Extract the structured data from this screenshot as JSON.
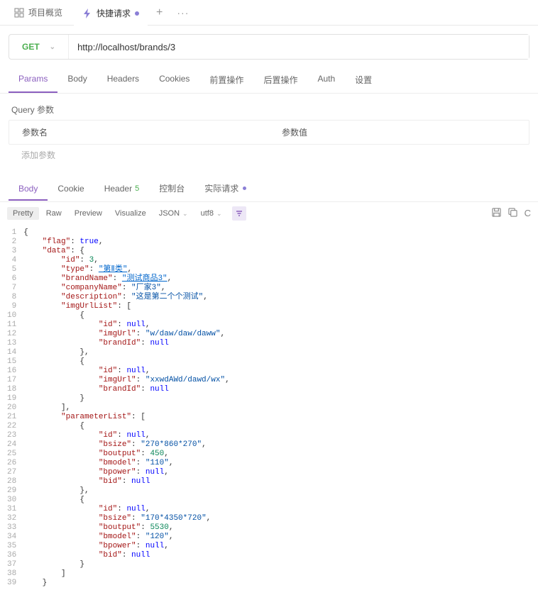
{
  "tabs": {
    "items": [
      {
        "label": "项目概览",
        "icon": "grid-icon"
      },
      {
        "label": "快捷请求",
        "icon": "lightning-icon",
        "active": true,
        "dirty": true
      }
    ],
    "plus": "+",
    "more": "···"
  },
  "request": {
    "method": "GET",
    "url": "http://localhost/brands/3"
  },
  "subTabs": [
    "Params",
    "Body",
    "Headers",
    "Cookies",
    "前置操作",
    "后置操作",
    "Auth",
    "设置"
  ],
  "activeSubTab": "Params",
  "query": {
    "title": "Query 参数",
    "colName": "参数名",
    "colValue": "参数值",
    "addPlaceholder": "添加参数"
  },
  "respTabs": [
    {
      "label": "Body",
      "active": true
    },
    {
      "label": "Cookie"
    },
    {
      "label": "Header",
      "badge": "5"
    },
    {
      "label": "控制台"
    },
    {
      "label": "实际请求",
      "dot": true
    }
  ],
  "format": {
    "modes": [
      "Pretty",
      "Raw",
      "Preview",
      "Visualize"
    ],
    "activeMode": "Pretty",
    "type": "JSON",
    "encoding": "utf8"
  },
  "json": {
    "flag": true,
    "data": {
      "id": 3,
      "type": "第Ⅱ类",
      "brandName": "测试商品3",
      "companyName": "厂家3",
      "description": "这是第二个个测试",
      "imgUrlList": [
        {
          "id": null,
          "imgUrl": "w/daw/daw/daww",
          "brandId": null
        },
        {
          "id": null,
          "imgUrl": "xxwdAWd/dawd/wx",
          "brandId": null
        }
      ],
      "parameterList": [
        {
          "id": null,
          "bsize": "270*860*270",
          "boutput": 450,
          "bmodel": "110",
          "bpower": null,
          "bid": null
        },
        {
          "id": null,
          "bsize": "170*4350*720",
          "boutput": 5530,
          "bmodel": "120",
          "bpower": null,
          "bid": null
        }
      ]
    }
  },
  "codeLines": 39
}
